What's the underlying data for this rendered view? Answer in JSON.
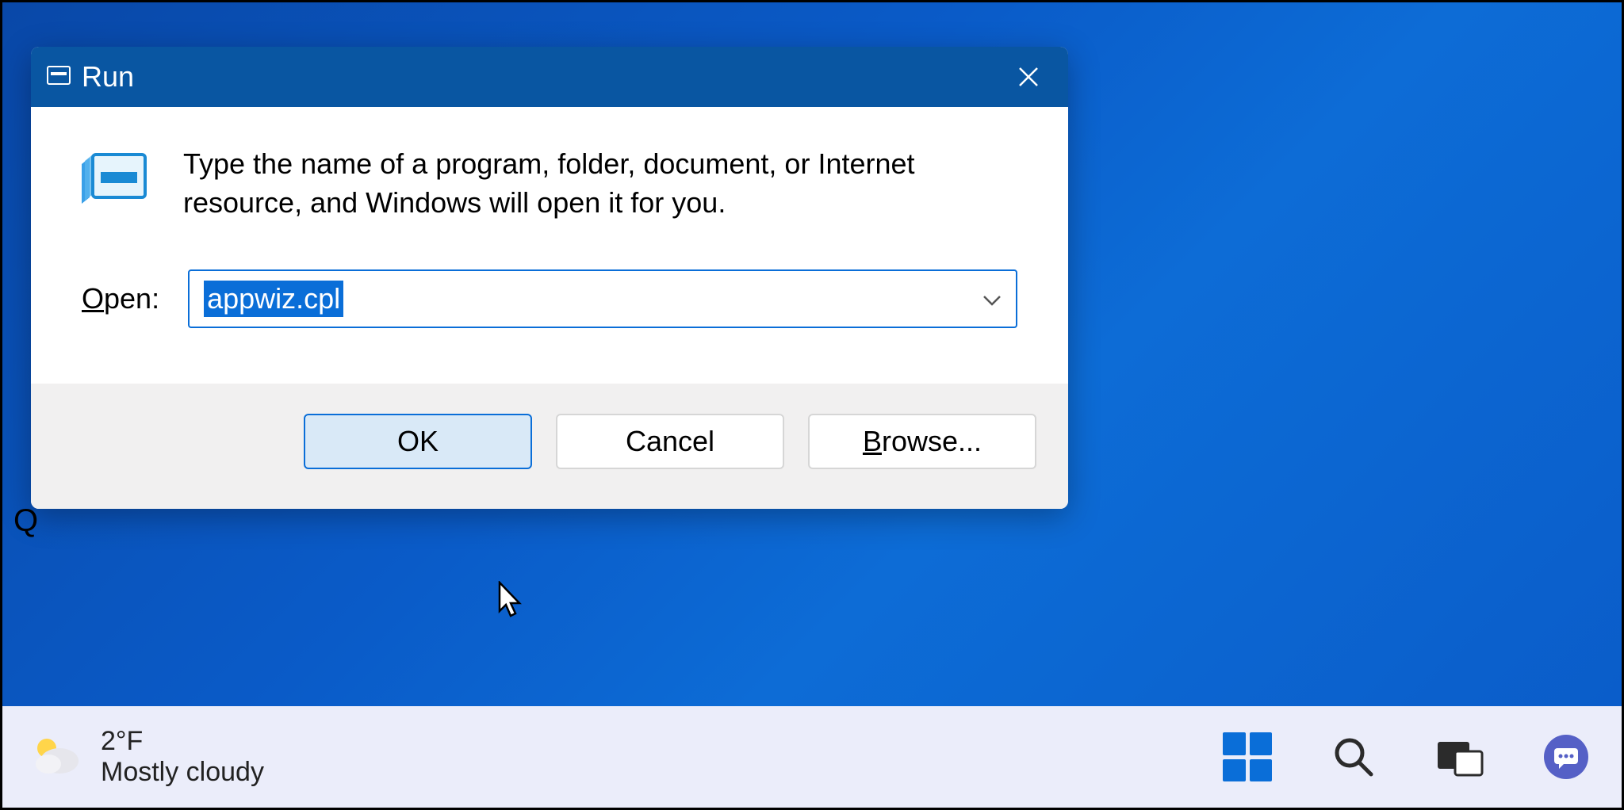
{
  "dialog": {
    "title": "Run",
    "description": "Type the name of a program, folder, document, or Internet resource, and Windows will open it for you.",
    "open_label_prefix": "O",
    "open_label_rest": "pen:",
    "input_value": "appwiz.cpl",
    "buttons": {
      "ok": "OK",
      "cancel": "Cancel",
      "browse_prefix": "B",
      "browse_rest": "rowse..."
    }
  },
  "taskbar": {
    "temperature": "2°F",
    "condition": "Mostly cloudy"
  },
  "misc": {
    "q_letter": "Q"
  }
}
